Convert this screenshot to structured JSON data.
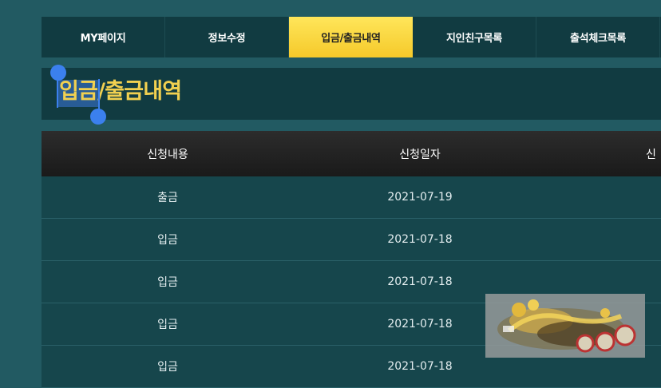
{
  "tabs": [
    {
      "label": "MY페이지"
    },
    {
      "label": "정보수정"
    },
    {
      "label": "입금/출금내역",
      "active": true
    },
    {
      "label": "지인친구목록"
    },
    {
      "label": "출석체크목록"
    }
  ],
  "page_title": "입금/출금내역",
  "table": {
    "headers": [
      "신청내용",
      "신청일자",
      "신"
    ],
    "rows": [
      {
        "type": "출금",
        "date": "2021-07-19"
      },
      {
        "type": "입금",
        "date": "2021-07-18"
      },
      {
        "type": "입금",
        "date": "2021-07-18"
      },
      {
        "type": "입금",
        "date": "2021-07-18"
      },
      {
        "type": "입금",
        "date": "2021-07-18"
      }
    ]
  },
  "colors": {
    "background": "#225a62",
    "panel": "#113b41",
    "active_tab": "#f5c92a",
    "title": "#f1d050",
    "selection": "#3b80ee"
  }
}
